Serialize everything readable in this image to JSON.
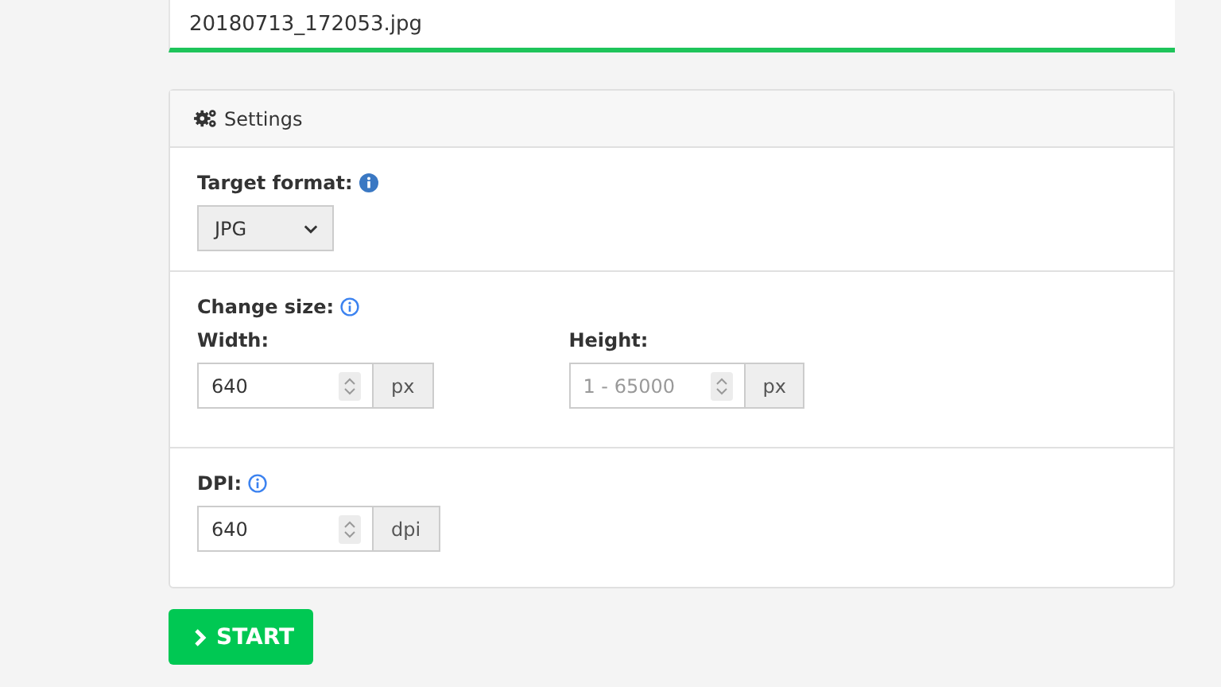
{
  "file": {
    "name": "20180713_172053.jpg"
  },
  "settings": {
    "title": "Settings",
    "target_format": {
      "label": "Target format:",
      "info_filled": true,
      "value": "JPG"
    },
    "change_size": {
      "label": "Change size:",
      "info_filled": false,
      "fields": [
        {
          "label": "Width:",
          "value": "640",
          "unit": "px"
        },
        {
          "label": "Height:",
          "placeholder": "1 - 65000",
          "unit": "px"
        }
      ]
    },
    "dpi": {
      "label": "DPI:",
      "info_filled": false,
      "value": "640",
      "unit": "dpi"
    }
  },
  "start_button": "START"
}
